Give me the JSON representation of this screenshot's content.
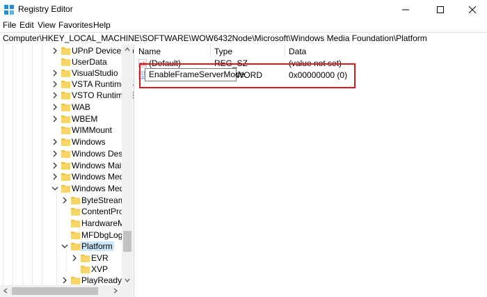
{
  "window": {
    "title": "Registry Editor"
  },
  "menu": [
    "File",
    "Edit",
    "View",
    "Favorites",
    "Help"
  ],
  "address": "Computer\\HKEY_LOCAL_MACHINE\\SOFTWARE\\WOW6432Node\\Microsoft\\Windows Media Foundation\\Platform",
  "tree": [
    {
      "label": "UPnP Device Ho"
    },
    {
      "label": "UserData"
    },
    {
      "label": "VisualStudio"
    },
    {
      "label": "VSTA Runtime S"
    },
    {
      "label": "VSTO Runtime S"
    },
    {
      "label": "WAB"
    },
    {
      "label": "WBEM"
    },
    {
      "label": "WIMMount"
    },
    {
      "label": "Windows"
    },
    {
      "label": "Windows Deskt"
    },
    {
      "label": "Windows Mail"
    },
    {
      "label": "Windows Media"
    },
    {
      "label": "Windows Media"
    },
    {
      "label": "ByteStreamH"
    },
    {
      "label": "ContentProt"
    },
    {
      "label": "HardwareMF"
    },
    {
      "label": "MFDbgLog"
    },
    {
      "label": "Platform"
    },
    {
      "label": "EVR"
    },
    {
      "label": "XVP"
    },
    {
      "label": "PlayReady"
    }
  ],
  "columns": {
    "name": "Name",
    "type": "Type",
    "data": "Data"
  },
  "values": [
    {
      "name": "(Default)",
      "type": "REG_SZ",
      "data": "(value not set)"
    },
    {
      "name": "EnableFrameServerMode",
      "type": "REG_DWORD",
      "data": "0x00000000 (0)"
    }
  ],
  "editing": {
    "name": "EnableFrameServerMode",
    "type_visible": "WORD"
  },
  "colors": {
    "highlight": "#d9191f",
    "selection": "#cce8ff",
    "folder": "#f2c34b"
  }
}
